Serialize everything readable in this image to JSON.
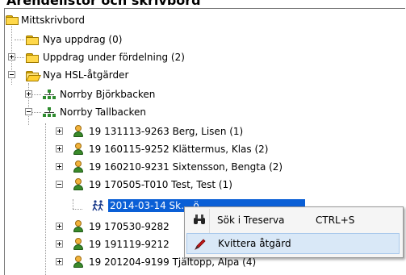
{
  "window": {
    "heading": "Ärendelistor och skrivbord"
  },
  "tree": {
    "root": "Mittskrivbord",
    "nya_uppdrag": "Nya uppdrag (0)",
    "uppdrag_fordelning": "Uppdrag under fördelning (2)",
    "nya_hsl": "Nya HSL-åtgärder",
    "bjorkbacken": "Norrby Björkbacken",
    "tallbacken": "Norrby Tallbacken",
    "patients": [
      "19 131113-9263  Berg, Lisen (1)",
      "19 160115-9252  Klättermus, Klas (2)",
      "19 160210-9231  Sixtensson, Bengta (2)",
      "19 170505-T010  Test, Test (1)"
    ],
    "selected_action": "2014-03-14  Sk... ö... ...",
    "patients_below": [
      "19 170530-9282",
      "19 191119-9212",
      "19 201204-9199  Tjältopp, Alpa (4)"
    ]
  },
  "context_menu": {
    "search_label": "Sök i Treserva",
    "search_shortcut": "CTRL+S",
    "acknowledge_label": "Kvittera åtgärd"
  },
  "icons": {
    "root": "desktop-folder-icon",
    "folder": "folder-icon",
    "open_folder": "open-folder-icon",
    "unit": "org-unit-icon",
    "patient": "patient-icon",
    "action": "walking-people-icon",
    "search": "binoculars-icon",
    "acknowledge": "pen-icon"
  },
  "colors": {
    "selection": "#0a5fd6",
    "menu_highlight": "#d9e8f7"
  }
}
